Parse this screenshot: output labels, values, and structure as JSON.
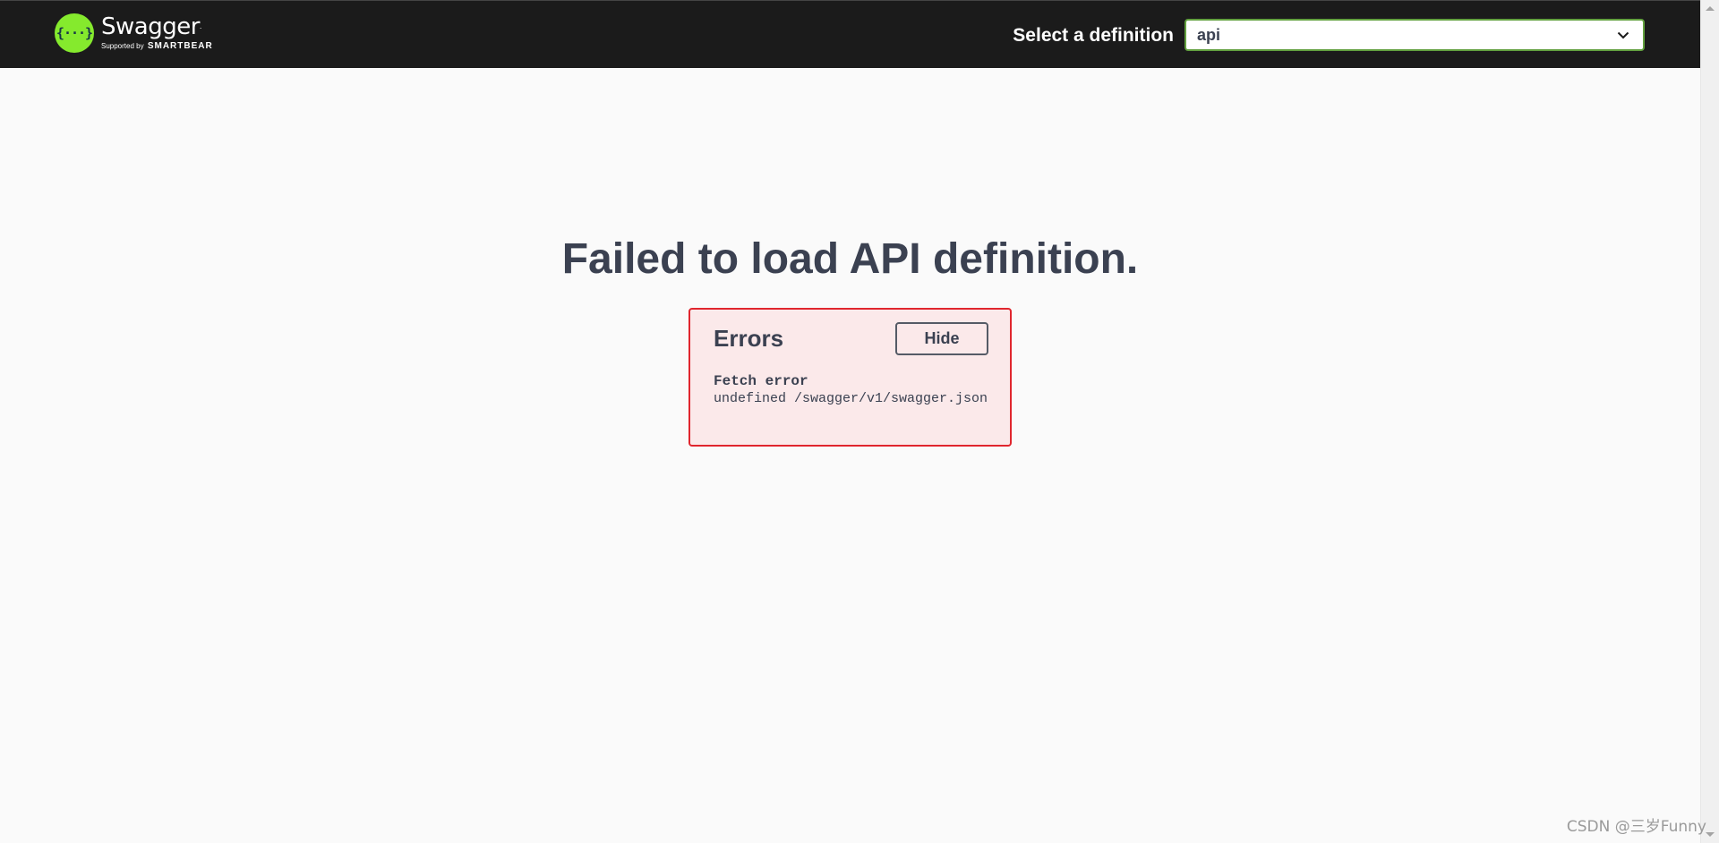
{
  "topbar": {
    "logo": {
      "name": "Swagger",
      "trademark": ".",
      "supported_by": "Supported by",
      "brand": "SMARTBEAR",
      "icon": "swagger-braces-icon",
      "mark_glyph": "{···}"
    },
    "select_label": "Select a definition",
    "select_value": "api",
    "accent_color": "#85ea2d",
    "select_border_color": "#62a03f"
  },
  "main": {
    "title": "Failed to load API definition.",
    "errors": {
      "title": "Errors",
      "hide_label": "Hide",
      "items": [
        {
          "heading": "Fetch error",
          "message": "undefined /swagger/v1/swagger.json"
        }
      ],
      "border_color": "#e0262e",
      "background_color": "#fbe9ea"
    }
  },
  "watermark": "CSDN @三岁Funny"
}
